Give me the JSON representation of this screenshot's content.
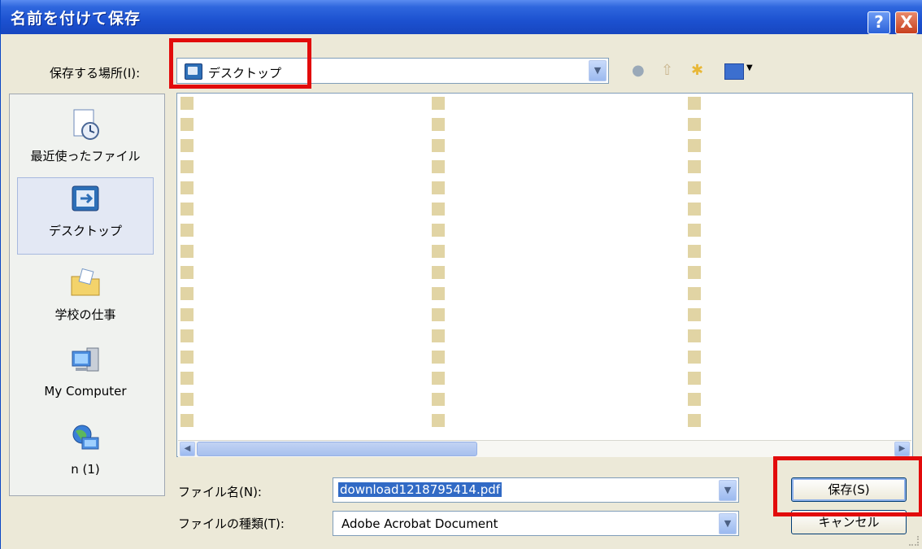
{
  "window": {
    "title": "名前を付けて保存",
    "help_label": "?",
    "close_label": "X"
  },
  "save_in": {
    "label": "保存する場所(I):",
    "value": "デスクトップ"
  },
  "toolbar": {
    "icons": [
      "back-icon",
      "up-folder-icon",
      "new-folder-icon",
      "views-menu-icon"
    ]
  },
  "places": {
    "items": [
      {
        "label": "最近使ったファイル",
        "icon": "recent-files-icon"
      },
      {
        "label": "デスクトップ",
        "icon": "desktop-icon",
        "selected": true
      },
      {
        "label": "学校の仕事",
        "icon": "documents-folder-icon"
      },
      {
        "label": "My Computer",
        "icon": "my-computer-icon"
      },
      {
        "label": "n (1)",
        "icon": "network-icon"
      }
    ]
  },
  "form": {
    "filename_label": "ファイル名(N):",
    "filename_value": "download1218795414.pdf",
    "filetype_label": "ファイルの種類(T):",
    "filetype_value": "Adobe Acrobat Document"
  },
  "buttons": {
    "save_label": "保存(S)",
    "cancel_label": "キャンセル"
  },
  "colors": {
    "highlight": "#e20b0b",
    "titlebar": "#1c51d0",
    "selection": "#316ac5"
  }
}
